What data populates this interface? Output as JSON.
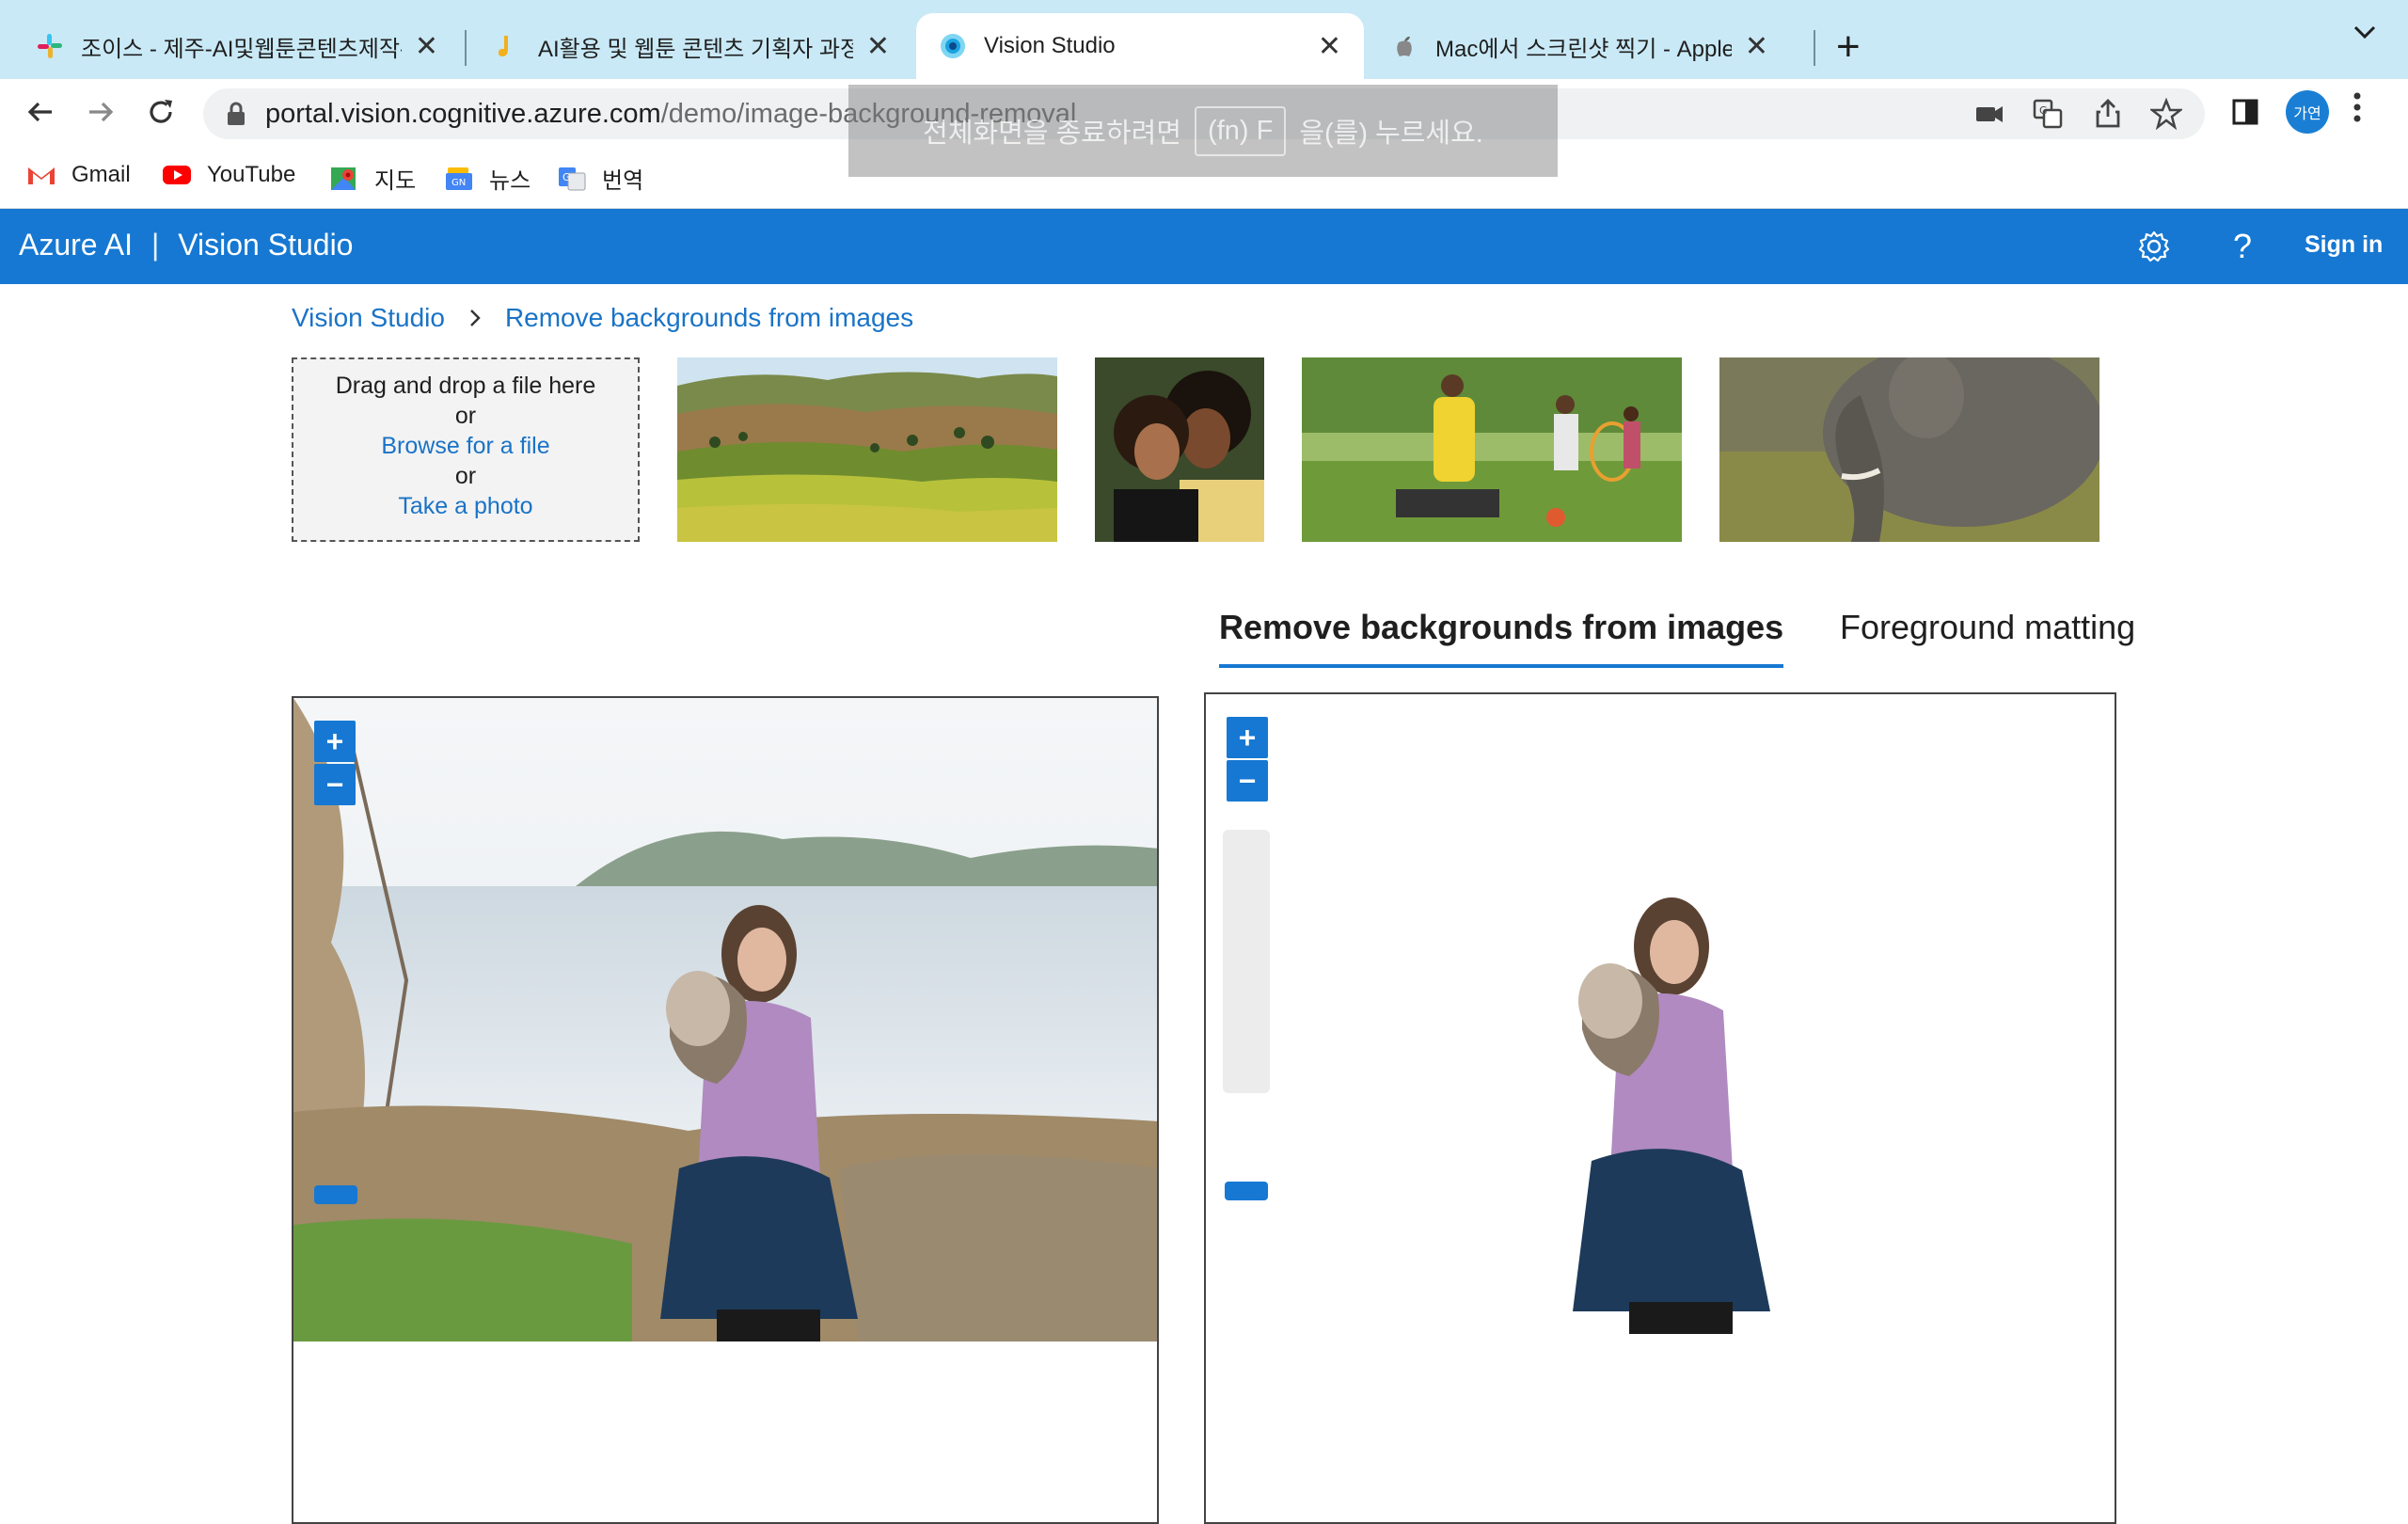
{
  "browser": {
    "tabs": [
      {
        "title": "조이스 - 제주-AI및웹툰콘텐츠제작-그",
        "active": false
      },
      {
        "title": "AI활용 및 웹툰 콘텐츠 기획자 과정 -",
        "active": false
      },
      {
        "title": "Vision Studio",
        "active": true
      },
      {
        "title": "Mac에서 스크린샷 찍기 - Apple 지",
        "active": false
      }
    ],
    "close_glyph": "✕",
    "new_tab_glyph": "+",
    "url_host": "portal.vision.cognitive.azure.com",
    "url_path": "/demo/image-background-removal",
    "profile_initials": "가연",
    "fullscreen_hint": {
      "before": "전체화면을 종료하려면",
      "key": "(fn) F",
      "after": "을(를) 누르세요."
    }
  },
  "bookmarks": [
    {
      "label": "Gmail",
      "icon": "gmail-icon"
    },
    {
      "label": "YouTube",
      "icon": "youtube-icon"
    },
    {
      "label": "지도",
      "icon": "maps-icon"
    },
    {
      "label": "뉴스",
      "icon": "news-icon"
    },
    {
      "label": "번역",
      "icon": "translate-icon"
    }
  ],
  "header": {
    "brand_left": "Azure AI",
    "brand_sep": "|",
    "brand_right": "Vision Studio",
    "help_glyph": "?",
    "sign_in": "Sign in",
    "accent": "#1678d2"
  },
  "breadcrumb": {
    "root": "Vision Studio",
    "current": "Remove backgrounds from images"
  },
  "dropzone": {
    "line1": "Drag and drop a file here",
    "or1": "or",
    "browse": "Browse for a file",
    "or2": "or",
    "photo": "Take a photo"
  },
  "samples": [
    "landscape-terraces",
    "couple-portrait",
    "family-bbq",
    "elephant"
  ],
  "result_tabs": {
    "remove": "Remove backgrounds from images",
    "matting": "Foreground matting"
  },
  "zoom": {
    "plus": "+",
    "minus": "−"
  }
}
